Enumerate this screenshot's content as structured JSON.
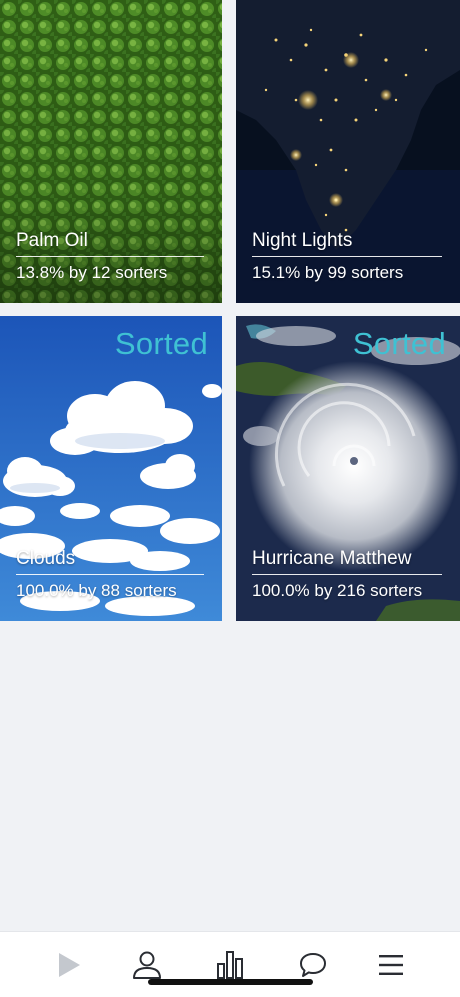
{
  "cards": [
    {
      "title": "Palm Oil",
      "stats": "13.8% by 12 sorters",
      "sorted": false,
      "image": "aerial-palm-plantation",
      "colors": {
        "base": "#3f7a1e",
        "light": "#6fae3a",
        "dark": "#1f4410"
      }
    },
    {
      "title": "Night Lights",
      "stats": "15.1% by 99 sorters",
      "sorted": false,
      "image": "night-lights-india",
      "colors": {
        "base": "#0d1628",
        "light": "#f3d27a",
        "dark": "#060b16"
      }
    },
    {
      "title": "Clouds",
      "stats": "100.0% by 88 sorters",
      "sorted": true,
      "sorted_label": "Sorted",
      "image": "cumulus-clouds-blue-sky",
      "colors": {
        "base": "#2a6fc9",
        "light": "#ffffff",
        "dark": "#1a4f9e"
      }
    },
    {
      "title": "Hurricane Matthew",
      "stats": "100.0% by 216 sorters",
      "sorted": true,
      "sorted_label": "Sorted",
      "image": "hurricane-satellite",
      "colors": {
        "base": "#1f2d4f",
        "light": "#e8eaee",
        "dark": "#0e1733"
      }
    }
  ],
  "accent_color": "#3fc1d3",
  "nav": {
    "items": [
      {
        "name": "play",
        "icon": "play-icon",
        "active": false
      },
      {
        "name": "profile",
        "icon": "user-icon",
        "active": false
      },
      {
        "name": "stats",
        "icon": "bar-chart-icon",
        "active": false
      },
      {
        "name": "chat",
        "icon": "chat-bubble-icon",
        "active": false
      },
      {
        "name": "menu",
        "icon": "hamburger-menu-icon",
        "active": false
      }
    ]
  }
}
